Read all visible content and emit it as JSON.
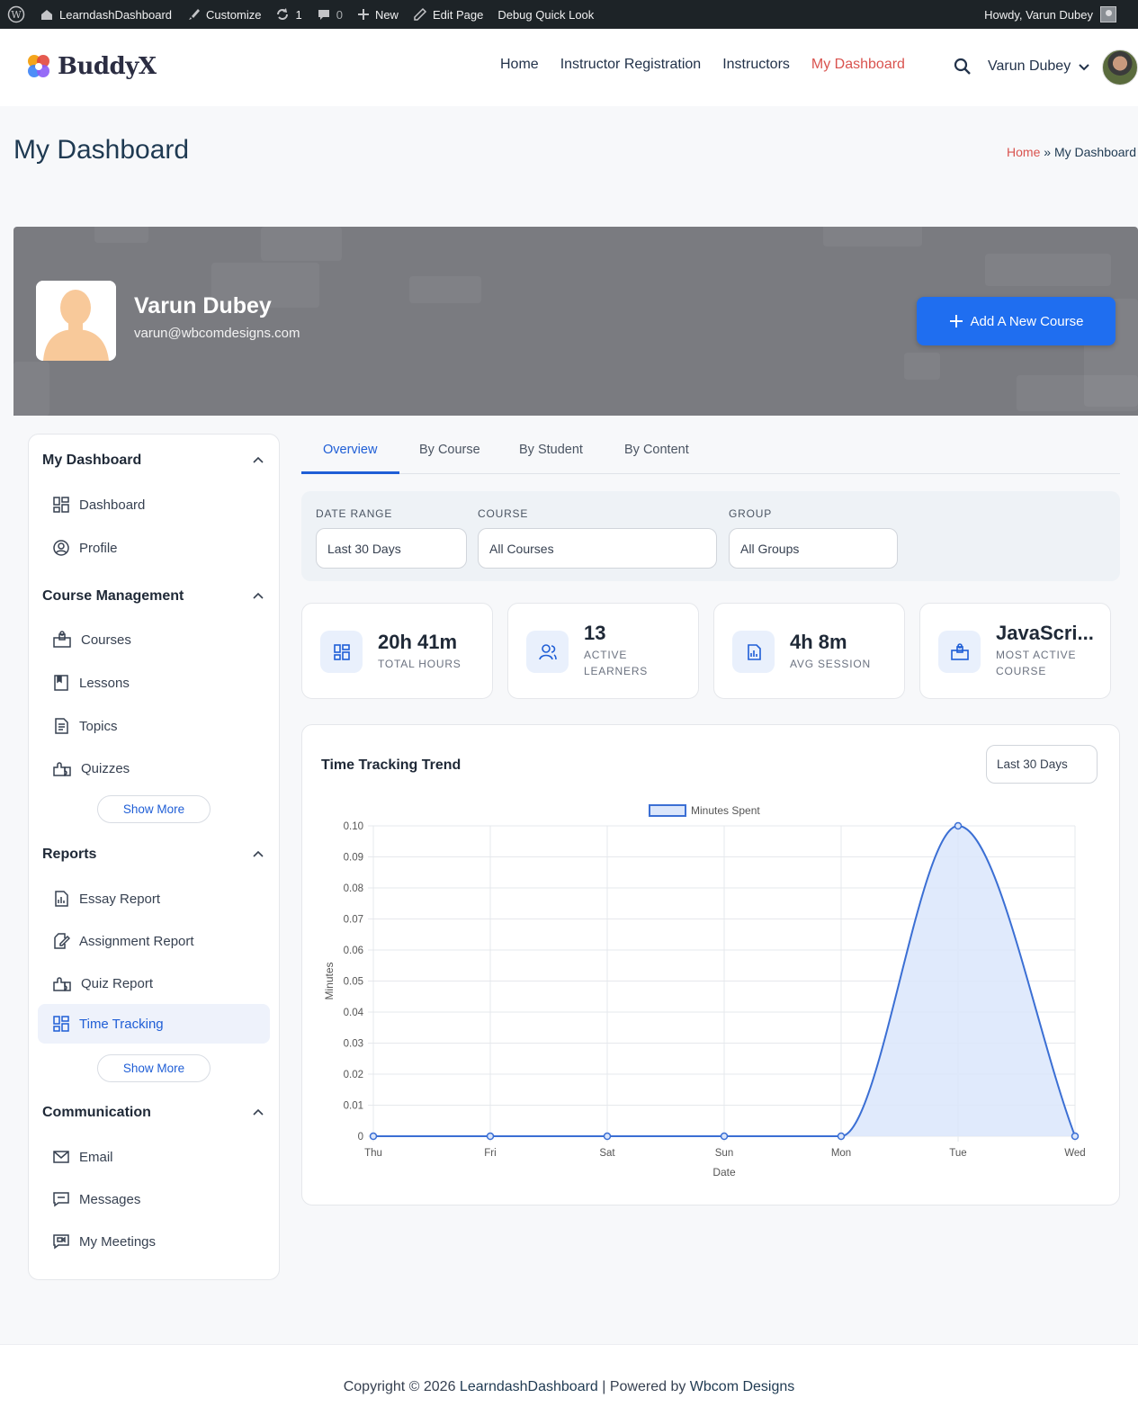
{
  "admin_bar": {
    "site_name": "LearndashDashboard",
    "customize": "Customize",
    "updates_count": "1",
    "comments_count": "0",
    "new": "New",
    "edit_page": "Edit Page",
    "debug": "Debug Quick Look",
    "howdy": "Howdy, Varun Dubey"
  },
  "header": {
    "logo": "BuddyX",
    "nav": [
      {
        "label": "Home",
        "active": false
      },
      {
        "label": "Instructor Registration",
        "active": false
      },
      {
        "label": "Instructors",
        "active": false
      },
      {
        "label": "My Dashboard",
        "active": true
      }
    ],
    "user_name": "Varun Dubey"
  },
  "page": {
    "title": "My Dashboard",
    "breadcrumb_home": "Home",
    "breadcrumb_sep": "»",
    "breadcrumb_current": "My Dashboard"
  },
  "profile": {
    "name": "Varun Dubey",
    "email": "varun@wbcomdesigns.com",
    "add_course_label": "Add A New Course"
  },
  "sidebar": {
    "sections": [
      {
        "title": "My Dashboard",
        "items": [
          {
            "label": "Dashboard",
            "icon": "dashboard-icon"
          },
          {
            "label": "Profile",
            "icon": "profile-icon"
          }
        ]
      },
      {
        "title": "Course Management",
        "items": [
          {
            "label": "Courses",
            "icon": "courses-icon"
          },
          {
            "label": "Lessons",
            "icon": "lessons-icon"
          },
          {
            "label": "Topics",
            "icon": "topics-icon"
          },
          {
            "label": "Quizzes",
            "icon": "quizzes-icon"
          }
        ],
        "show_more": "Show More"
      },
      {
        "title": "Reports",
        "items": [
          {
            "label": "Essay Report",
            "icon": "essay-report-icon"
          },
          {
            "label": "Assignment Report",
            "icon": "assignment-report-icon"
          },
          {
            "label": "Quiz Report",
            "icon": "quiz-report-icon"
          },
          {
            "label": "Time Tracking",
            "icon": "time-tracking-icon",
            "active": true
          }
        ],
        "show_more": "Show More"
      },
      {
        "title": "Communication",
        "items": [
          {
            "label": "Email",
            "icon": "email-icon"
          },
          {
            "label": "Messages",
            "icon": "messages-icon"
          },
          {
            "label": "My Meetings",
            "icon": "meetings-icon"
          }
        ]
      }
    ]
  },
  "tabs": [
    {
      "label": "Overview",
      "active": true
    },
    {
      "label": "By Course",
      "active": false
    },
    {
      "label": "By Student",
      "active": false
    },
    {
      "label": "By Content",
      "active": false
    }
  ],
  "filters": {
    "date_range": {
      "label": "DATE RANGE",
      "value": "Last 30 Days"
    },
    "course": {
      "label": "COURSE",
      "value": "All Courses"
    },
    "group": {
      "label": "GROUP",
      "value": "All Groups"
    }
  },
  "stats": [
    {
      "value": "20h 41m",
      "label": "TOTAL HOURS",
      "icon": "grid-icon"
    },
    {
      "value": "13",
      "label_line1": "ACTIVE",
      "label_line2": "LEARNERS",
      "icon": "users-icon"
    },
    {
      "value": "4h 8m",
      "label": "AVG SESSION",
      "icon": "report-icon"
    },
    {
      "value": "JavaScri...",
      "label_line1": "MOST ACTIVE",
      "label_line2": "COURSE",
      "icon": "course-icon"
    }
  ],
  "chart_section": {
    "title": "Time Tracking Trend",
    "range": "Last 30 Days"
  },
  "chart_data": {
    "type": "area",
    "x": [
      "Thu",
      "Fri",
      "Sat",
      "Sun",
      "Mon",
      "Tue",
      "Wed"
    ],
    "series": [
      {
        "name": "Minutes Spent",
        "values": [
          0,
          0,
          0,
          0,
          0,
          0.1,
          0
        ]
      }
    ],
    "xlabel": "Date",
    "ylabel": "Minutes",
    "ylim": [
      0,
      0.1
    ],
    "yticks": [
      "0",
      "0.01",
      "0.02",
      "0.03",
      "0.04",
      "0.05",
      "0.06",
      "0.07",
      "0.08",
      "0.09",
      "0.10"
    ],
    "grid": true,
    "legend_position": "top-center",
    "colors": {
      "line": "#3b6fd4",
      "fill": "#dbe6fb"
    }
  },
  "footer": {
    "prefix": "Copyright © 2026 ",
    "site": "LearndashDashboard",
    "middle": " | Powered by ",
    "powered": "Wbcom Designs"
  },
  "colors": {
    "accent": "#1f6ef0",
    "nav_active": "#d9534f",
    "admin_bar": "#1d2327"
  }
}
